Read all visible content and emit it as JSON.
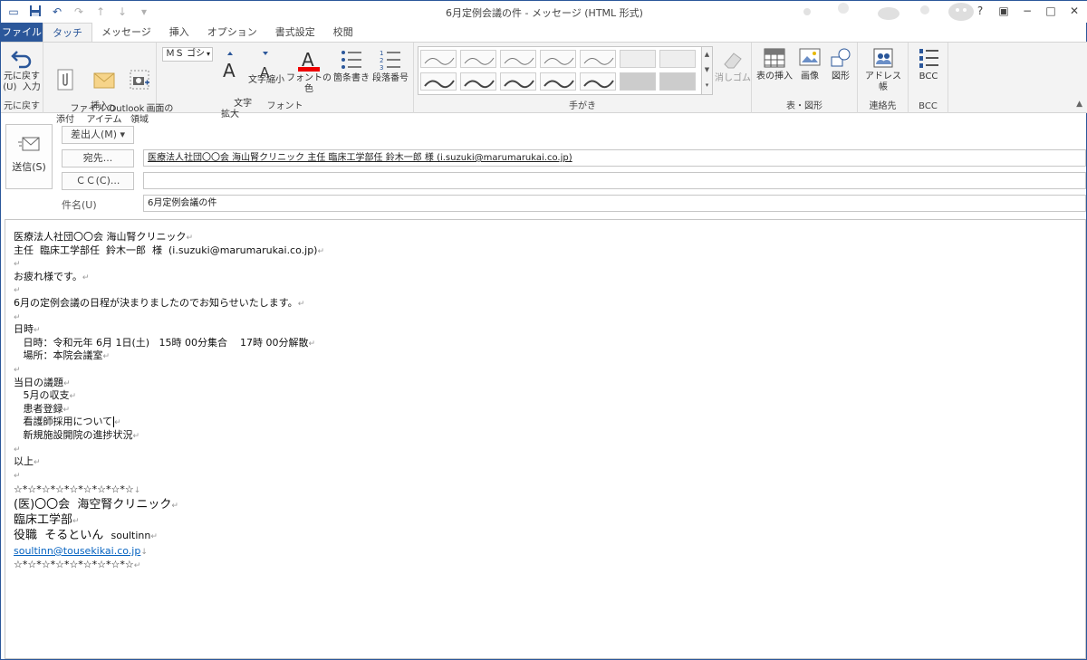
{
  "window": {
    "title": "6月定例会議の件 - メッセージ (HTML 形式)",
    "qat": {
      "save_icon": "save-icon",
      "undo_icon": "undo-icon"
    },
    "controls": {
      "help": "?",
      "minimize": "−",
      "maximize": "□",
      "close": "✕"
    }
  },
  "tabs": [
    {
      "label": "ファイル"
    },
    {
      "label": "タッチ"
    },
    {
      "label": "メッセージ"
    },
    {
      "label": "挿入"
    },
    {
      "label": "オプション"
    },
    {
      "label": "書式設定"
    },
    {
      "label": "校閲"
    }
  ],
  "ribbon": {
    "undo": {
      "label1": "元に戻す",
      "label2": "(U)  入力",
      "group": "元に戻す"
    },
    "insert": {
      "attach": "ファイルの\n添付",
      "outlook": "Outlook\nアイテム",
      "screen": "画面の\n領域",
      "group": "挿入"
    },
    "font": {
      "font_name": "ＭＳ ゴシ",
      "grow": "文字\n拡大",
      "shrink": "文字縮小",
      "color": "フォントの色",
      "bullets": "箇条書き",
      "numbering": "段落番号",
      "group": "フォント"
    },
    "handwriting": {
      "eraser": "消しゴム",
      "group": "手がき"
    },
    "table_shape": {
      "table": "表の挿入",
      "image": "画像",
      "shape": "図形",
      "group": "表・図形"
    },
    "contacts": {
      "address": "アドレス帳",
      "group": "連絡先"
    },
    "bcc": {
      "bcc": "BCC",
      "group": "BCC"
    }
  },
  "header": {
    "send_label": "送信(S)",
    "from_label": "差出人(M) ▾",
    "to_label": "宛先...",
    "cc_label": "ＣＣ(C)...",
    "subject_label": "件名(U)",
    "to_value": "医療法人社団〇〇会 海山腎クリニック 主任 臨床工学部任 鈴木一郎 様 (i.suzuki@marumarukai.co.jp)",
    "cc_value": "",
    "subject_value": "6月定例会議の件"
  },
  "body": {
    "lines": [
      "医療法人社団〇〇会 海山腎クリニック",
      "主任  臨床工学部任  鈴木一郎  様  (i.suzuki@marumarukai.co.jp)",
      "",
      "お疲れ様です。",
      "",
      "6月の定例会議の日程が決まりましたのでお知らせいたします。",
      "",
      "日時",
      "   日時：令和元年 6月 1日(土)   15時 00分集合    17時 00分解散",
      "   場所：本院会議室",
      "",
      "当日の議題",
      "   5月の収支",
      "   患者登録",
      "   看護師採用について",
      "   新規施設開院の進捗状況",
      "",
      "以上",
      ""
    ],
    "signature": {
      "stars_top": "☆*☆*☆*☆*☆*☆*☆*☆*☆",
      "org": "(医)〇〇会  海空腎クリニック",
      "dept": "臨床工学部",
      "role": "役職  そるといん",
      "role_en": "soultinn",
      "email": "soultinn@tousekikai.co.jp",
      "stars_bottom": "☆*☆*☆*☆*☆*☆*☆*☆*☆"
    }
  }
}
